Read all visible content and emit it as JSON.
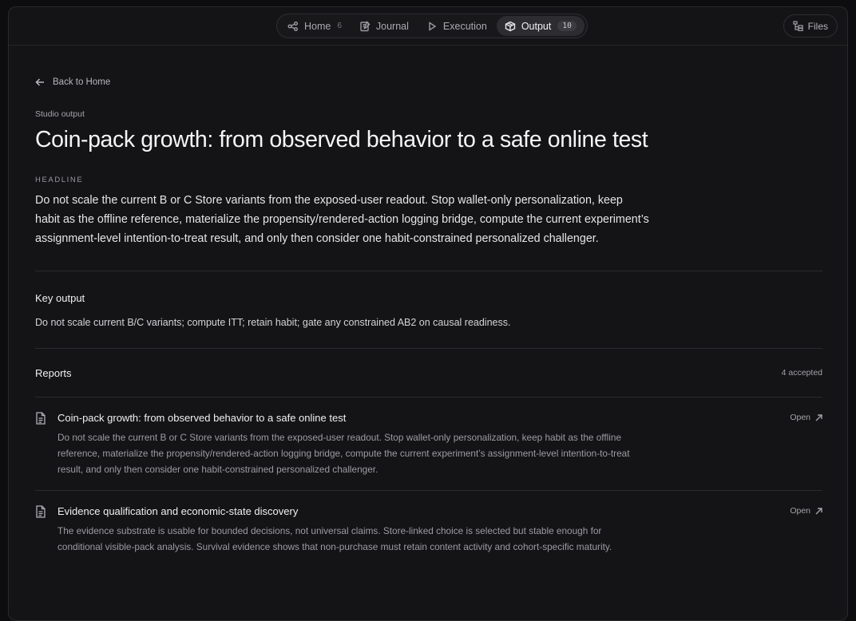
{
  "nav": {
    "tabs": [
      {
        "label": "Home",
        "count": "6",
        "icon": "home-graph-icon"
      },
      {
        "label": "Journal",
        "icon": "journal-icon"
      },
      {
        "label": "Execution",
        "icon": "play-icon"
      },
      {
        "label": "Output",
        "count": "10",
        "icon": "box-icon",
        "active": true
      }
    ],
    "files_label": "Files"
  },
  "back_label": "Back to Home",
  "eyebrow": "Studio output",
  "title": "Coin-pack growth: from observed behavior to a safe online test",
  "headline": {
    "label": "HEADLINE",
    "text": "Do not scale the current B or C Store variants from the exposed-user readout. Stop wallet-only personalization, keep habit as the offline reference, materialize the propensity/rendered-action logging bridge, compute the current experiment’s assignment-level intention-to-treat result, and only then consider one habit-constrained personalized challenger."
  },
  "key_output": {
    "title": "Key output",
    "text": "Do not scale current B/C variants; compute ITT; retain habit; gate any constrained AB2 on causal readiness."
  },
  "reports": {
    "title": "Reports",
    "count": "4 accepted",
    "items": [
      {
        "title": "Coin-pack growth: from observed behavior to a safe online test",
        "desc": "Do not scale the current B or C Store variants from the exposed-user readout. Stop wallet-only personalization, keep habit as the offline reference, materialize the propensity/rendered-action logging bridge, compute the current experiment’s assignment-level intention-to-treat result, and only then consider one habit-constrained personalized challenger.",
        "open": "Open"
      },
      {
        "title": "Evidence qualification and economic-state discovery",
        "desc": "The evidence substrate is usable for bounded decisions, not universal claims. Store-linked choice is selected but stable enough for conditional visible-pack analysis. Survival evidence shows that non-purchase must retain content activity and cohort-specific maturity.",
        "open": "Open"
      }
    ]
  }
}
